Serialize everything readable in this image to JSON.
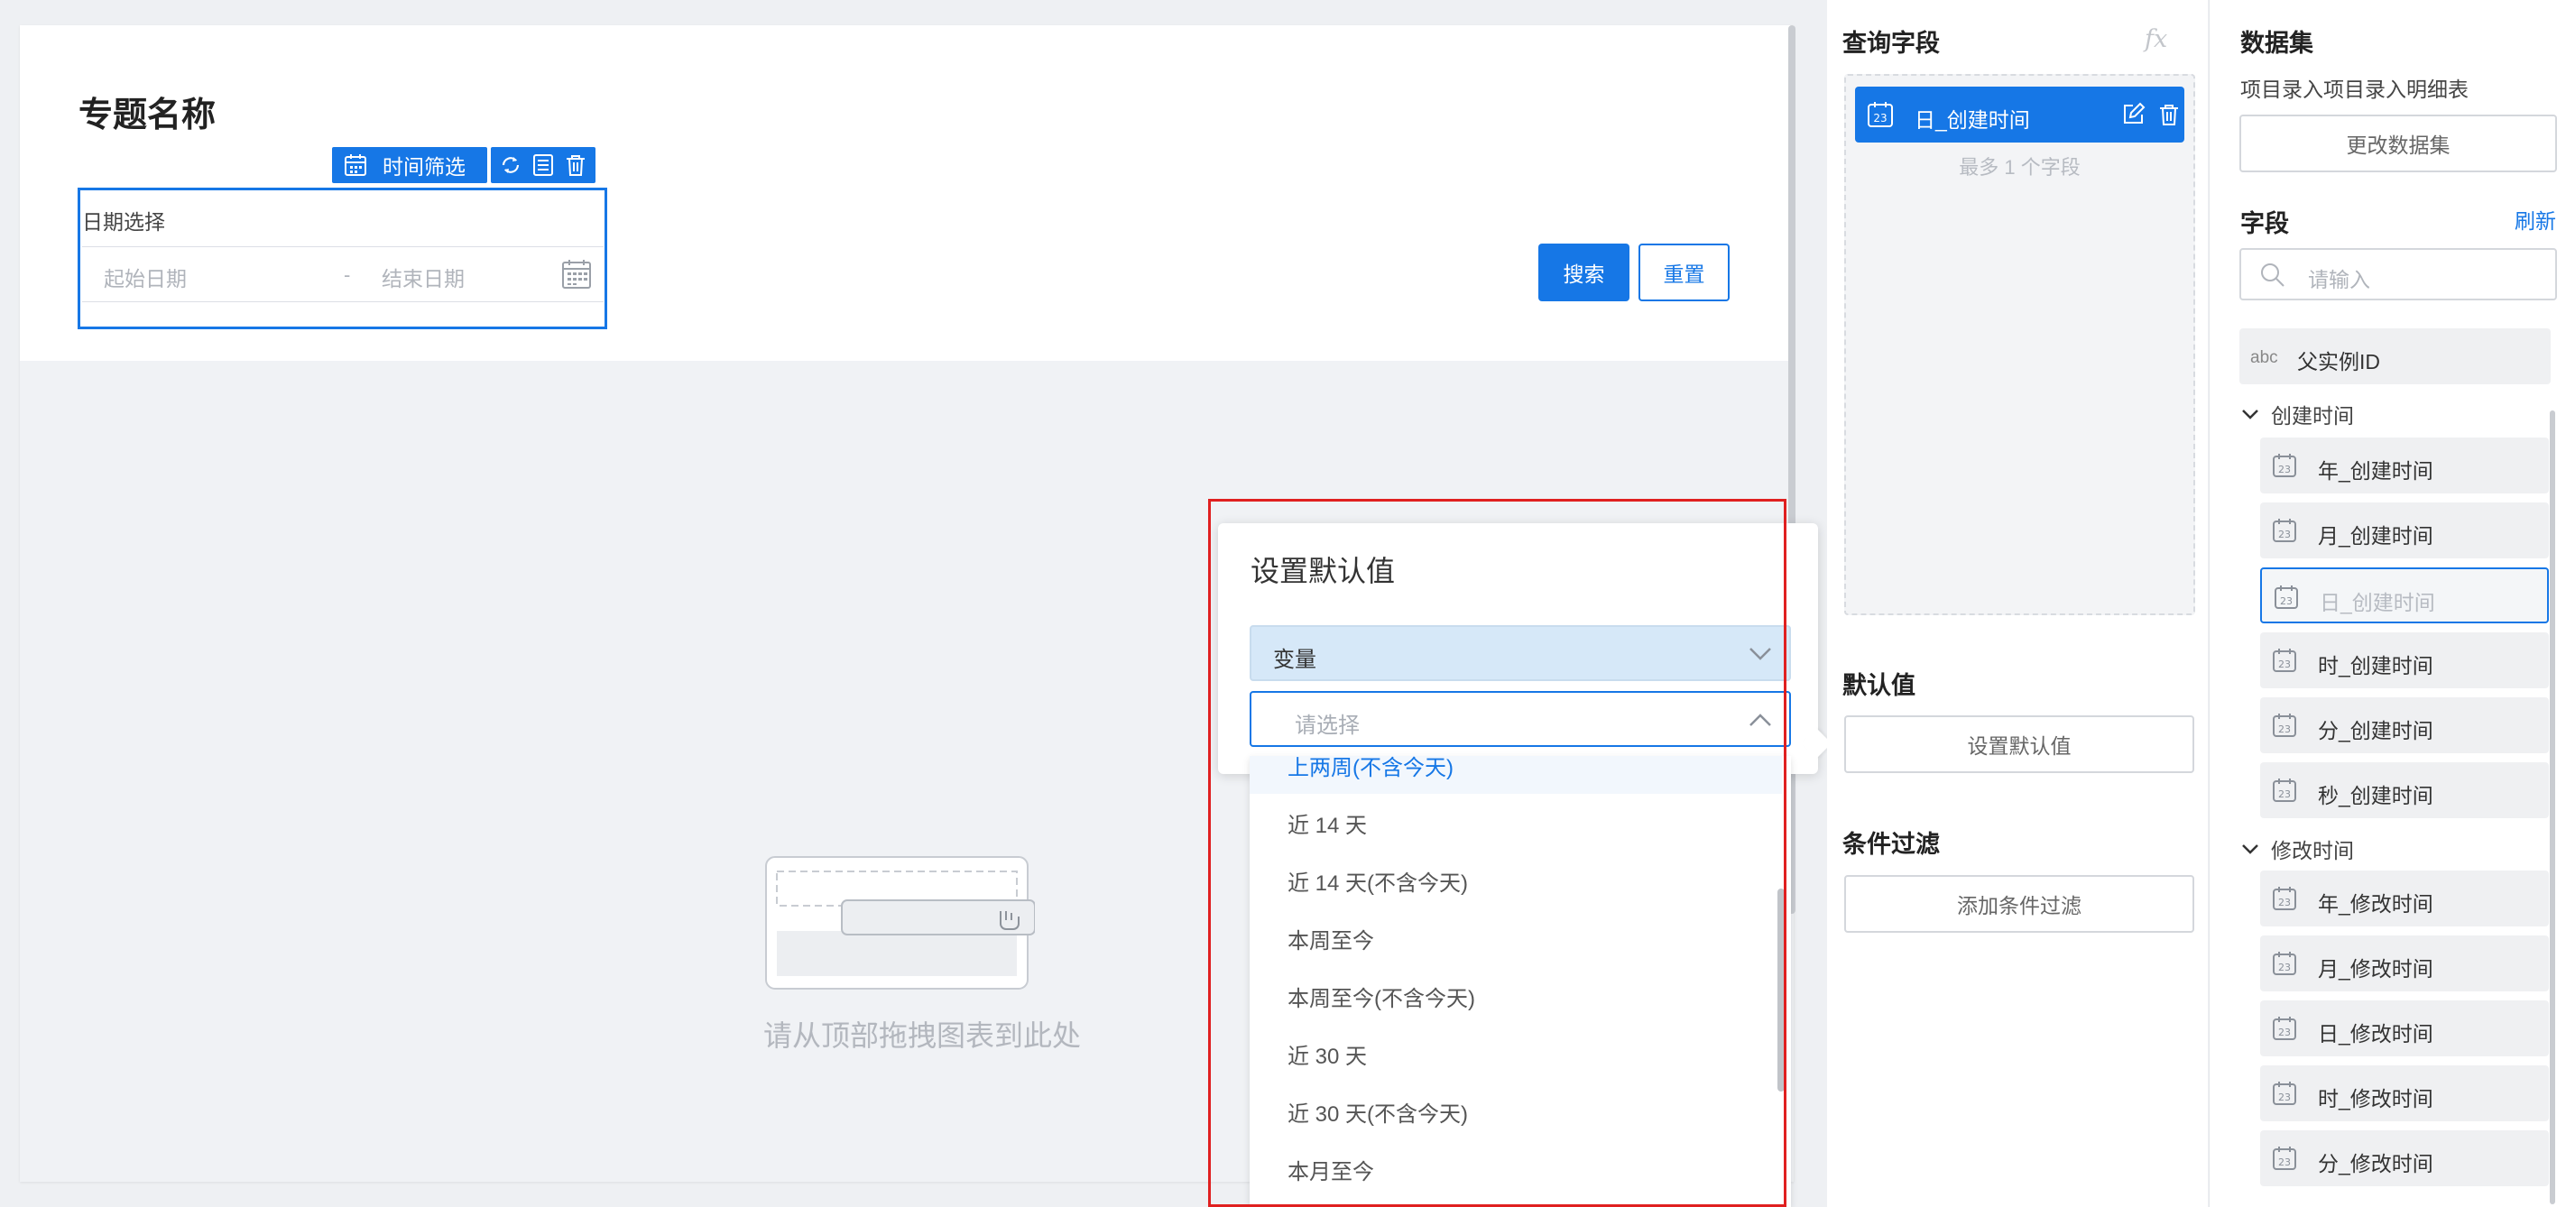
{
  "canvas": {
    "topic_title": "专题名称",
    "widget_toolbar_label": "时间筛选",
    "date_widget": {
      "label": "日期选择",
      "start_placeholder": "起始日期",
      "range_separator": "-",
      "end_placeholder": "结束日期"
    },
    "search_label": "搜索",
    "reset_label": "重置",
    "empty_hint": "请从顶部拖拽图表到此处"
  },
  "popover": {
    "title": "设置默认值",
    "type_value": "变量",
    "variable_placeholder": "请选择",
    "options": [
      {
        "label": "上两周(不含今天)",
        "active": true
      },
      {
        "label": "近 14 天",
        "active": false
      },
      {
        "label": "近 14 天(不含今天)",
        "active": false
      },
      {
        "label": "本周至今",
        "active": false
      },
      {
        "label": "本周至今(不含今天)",
        "active": false
      },
      {
        "label": "近 30 天",
        "active": false
      },
      {
        "label": "近 30 天(不含今天)",
        "active": false
      },
      {
        "label": "本月至今",
        "active": false
      }
    ]
  },
  "config": {
    "query_fields_title": "查询字段",
    "fx_label": "fx",
    "query_chip_label": "日_创建时间",
    "max_fields_hint": "最多 1 个字段",
    "default_value_title": "默认值",
    "set_default_label": "设置默认值",
    "condition_filter_title": "条件过滤",
    "add_filter_label": "添加条件过滤"
  },
  "dataset": {
    "title": "数据集",
    "name": "项目录入项目录入明细表",
    "change_label": "更改数据集",
    "fields_title": "字段",
    "refresh_label": "刷新",
    "search_placeholder": "请输入",
    "abc_tag": "abc",
    "parent_field": "父实例ID",
    "groups": [
      {
        "name": "创建时间",
        "items": [
          "年_创建时间",
          "月_创建时间",
          "日_创建时间",
          "时_创建时间",
          "分_创建时间",
          "秒_创建时间"
        ],
        "selected": 2
      },
      {
        "name": "修改时间",
        "items": [
          "年_修改时间",
          "月_修改时间",
          "日_修改时间",
          "时_修改时间",
          "分_修改时间"
        ],
        "selected": -1
      }
    ]
  },
  "colors": {
    "primary": "#1677e6",
    "highlight": "#e02020"
  }
}
